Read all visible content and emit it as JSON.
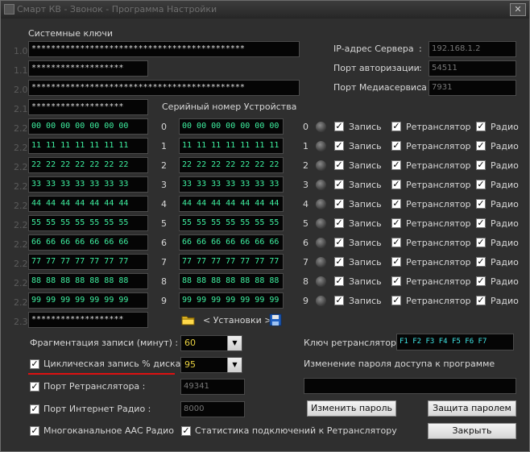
{
  "window": {
    "title": "Смарт КВ - Звонок - Программа Настройки",
    "close_label": "✕"
  },
  "section_keys_label": "Системные ключи",
  "system_keys": [
    {
      "idx": "1.0",
      "value": "********************************************"
    },
    {
      "idx": "1.1",
      "value": "*******************"
    },
    {
      "idx": "2.0",
      "value": "********************************************"
    },
    {
      "idx": "2.1",
      "value": "*******************"
    }
  ],
  "server": {
    "ip_label": "IP-адрес Сервера",
    "ip_value": "192.168.1.2",
    "auth_port_label": "Порт авторизации",
    "auth_port_value": "54511",
    "media_port_label": "Порт Медиасервиса",
    "media_port_value": "7931"
  },
  "device_serial_label": "Серийный номер Устройства",
  "device_rows": [
    {
      "idx": "2.2",
      "left": "00 00 00 00 00 00 00",
      "num": "0",
      "serial": "00 00 00 00 00 00 00",
      "ch": "0",
      "rec": "Запись",
      "rel": "Ретранслятор",
      "radio": "Радио"
    },
    {
      "idx": "2.2",
      "left": "11 11 11 11 11 11 11",
      "num": "1",
      "serial": "11 11 11 11 11 11 11",
      "ch": "1",
      "rec": "Запись",
      "rel": "Ретранслятор",
      "radio": "Радио"
    },
    {
      "idx": "2.2",
      "left": "22 22 22 22 22 22 22",
      "num": "2",
      "serial": "22 22 22 22 22 22 22",
      "ch": "2",
      "rec": "Запись",
      "rel": "Ретранслятор",
      "radio": "Радио"
    },
    {
      "idx": "2.2",
      "left": "33 33 33 33 33 33 33",
      "num": "3",
      "serial": "33 33 33 33 33 33 33",
      "ch": "3",
      "rec": "Запись",
      "rel": "Ретранслятор",
      "radio": "Радио"
    },
    {
      "idx": "2.2",
      "left": "44 44 44 44 44 44 44",
      "num": "4",
      "serial": "44 44 44 44 44 44 44",
      "ch": "4",
      "rec": "Запись",
      "rel": "Ретранслятор",
      "radio": "Радио"
    },
    {
      "idx": "2.2",
      "left": "55 55 55 55 55 55 55",
      "num": "5",
      "serial": "55 55 55 55 55 55 55",
      "ch": "5",
      "rec": "Запись",
      "rel": "Ретранслятор",
      "radio": "Радио"
    },
    {
      "idx": "2.2",
      "left": "66 66 66 66 66 66 66",
      "num": "6",
      "serial": "66 66 66 66 66 66 66",
      "ch": "6",
      "rec": "Запись",
      "rel": "Ретранслятор",
      "radio": "Радио"
    },
    {
      "idx": "2.2",
      "left": "77 77 77 77 77 77 77",
      "num": "7",
      "serial": "77 77 77 77 77 77 77",
      "ch": "7",
      "rec": "Запись",
      "rel": "Ретранслятор",
      "radio": "Радио"
    },
    {
      "idx": "2.2",
      "left": "88 88 88 88 88 88 88",
      "num": "8",
      "serial": "88 88 88 88 88 88 88",
      "ch": "8",
      "rec": "Запись",
      "rel": "Ретранслятор",
      "radio": "Радио"
    },
    {
      "idx": "2.2",
      "left": "99 99 99 99 99 99 99",
      "num": "9",
      "serial": "99 99 99 99 99 99 99",
      "ch": "9",
      "rec": "Запись",
      "rel": "Ретранслятор",
      "radio": "Радио"
    }
  ],
  "key_23": {
    "idx": "2.3",
    "value": "*******************"
  },
  "installs_label": "< Установки >",
  "fragmentation": {
    "label": "Фрагментация записи (минут) :",
    "value": "60"
  },
  "cyclic": {
    "label": "Циклическая запись % диска :",
    "value": "95",
    "checked": "✓"
  },
  "relay_port": {
    "label": "Порт Ретранслятора :",
    "value": "49341",
    "checked": "✓"
  },
  "radio_port": {
    "label": "Порт Интернет Радио :",
    "value": "8000",
    "checked": "✓"
  },
  "aac": {
    "label": "Многоканальное ААС Радио",
    "checked": "✓"
  },
  "stats": {
    "label": "Статистика подключений к Ретранслятору",
    "checked": "✓"
  },
  "relay_key": {
    "label": "Ключ ретранслятора",
    "value": "F1 F2 F3 F4 F5 F6 F7"
  },
  "password_change_label": "Изменение пароля доступа к программе",
  "buttons": {
    "change_password": "Изменить пароль",
    "protect": "Защита паролем",
    "close": "Закрыть"
  },
  "colors": {
    "background": "#2f2f2f",
    "field_bg": "#050505",
    "hex_green": "#3ef0a0",
    "value_yellow": "#e8d040",
    "relay_key_cyan": "#3ee6e6",
    "underline_red": "#dd1111"
  }
}
